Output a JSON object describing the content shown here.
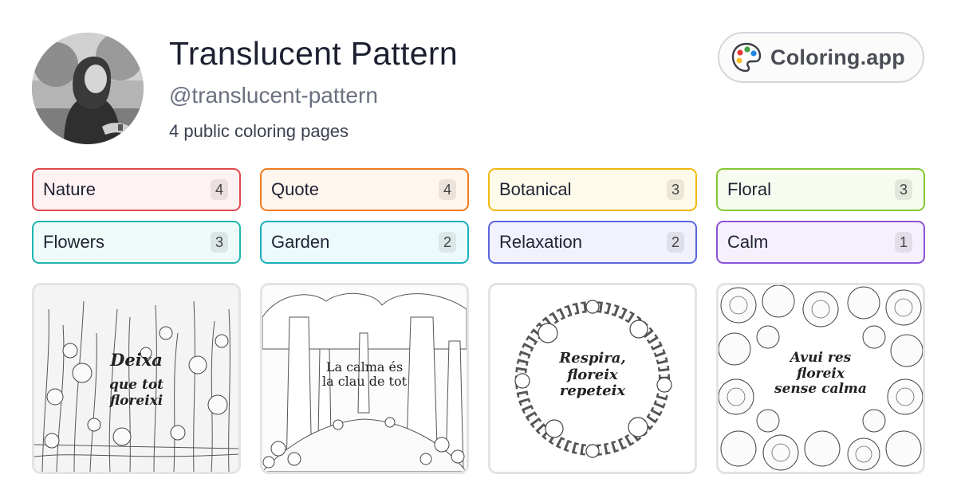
{
  "profile": {
    "name": "Translucent Pattern",
    "handle": "@translucent-pattern",
    "page_count_text": "4 public coloring pages"
  },
  "brand": {
    "label": "Coloring.app",
    "icon": "palette-icon",
    "palette_colors": [
      "#e53935",
      "#43a047",
      "#1e88e5",
      "#fbc02d"
    ]
  },
  "tags": [
    {
      "label": "Nature",
      "count": "4",
      "color": "#e0494d",
      "bg": "#fff2f2"
    },
    {
      "label": "Quote",
      "count": "4",
      "color": "#f07b1e",
      "bg": "#fff6ee"
    },
    {
      "label": "Botanical",
      "count": "3",
      "color": "#f2b80d",
      "bg": "#fffbea"
    },
    {
      "label": "Floral",
      "count": "3",
      "color": "#84c934",
      "bg": "#f6fcef"
    },
    {
      "label": "Flowers",
      "count": "3",
      "color": "#1fb5ad",
      "bg": "#eefbfa"
    },
    {
      "label": "Garden",
      "count": "2",
      "color": "#1ab0be",
      "bg": "#edfafb"
    },
    {
      "label": "Relaxation",
      "count": "2",
      "color": "#5a66dd",
      "bg": "#f1f2fd"
    },
    {
      "label": "Calm",
      "count": "1",
      "color": "#8a52d8",
      "bg": "#f6f0fd"
    }
  ],
  "cards": [
    {
      "lines": [
        "Deixa",
        "que tot",
        "floreixi"
      ]
    },
    {
      "lines": [
        "La calma és",
        "la clau de tot"
      ]
    },
    {
      "lines": [
        "Respira,",
        "floreix",
        "repeteix"
      ]
    },
    {
      "lines": [
        "Avui res",
        "floreix",
        "sense calma"
      ]
    }
  ]
}
